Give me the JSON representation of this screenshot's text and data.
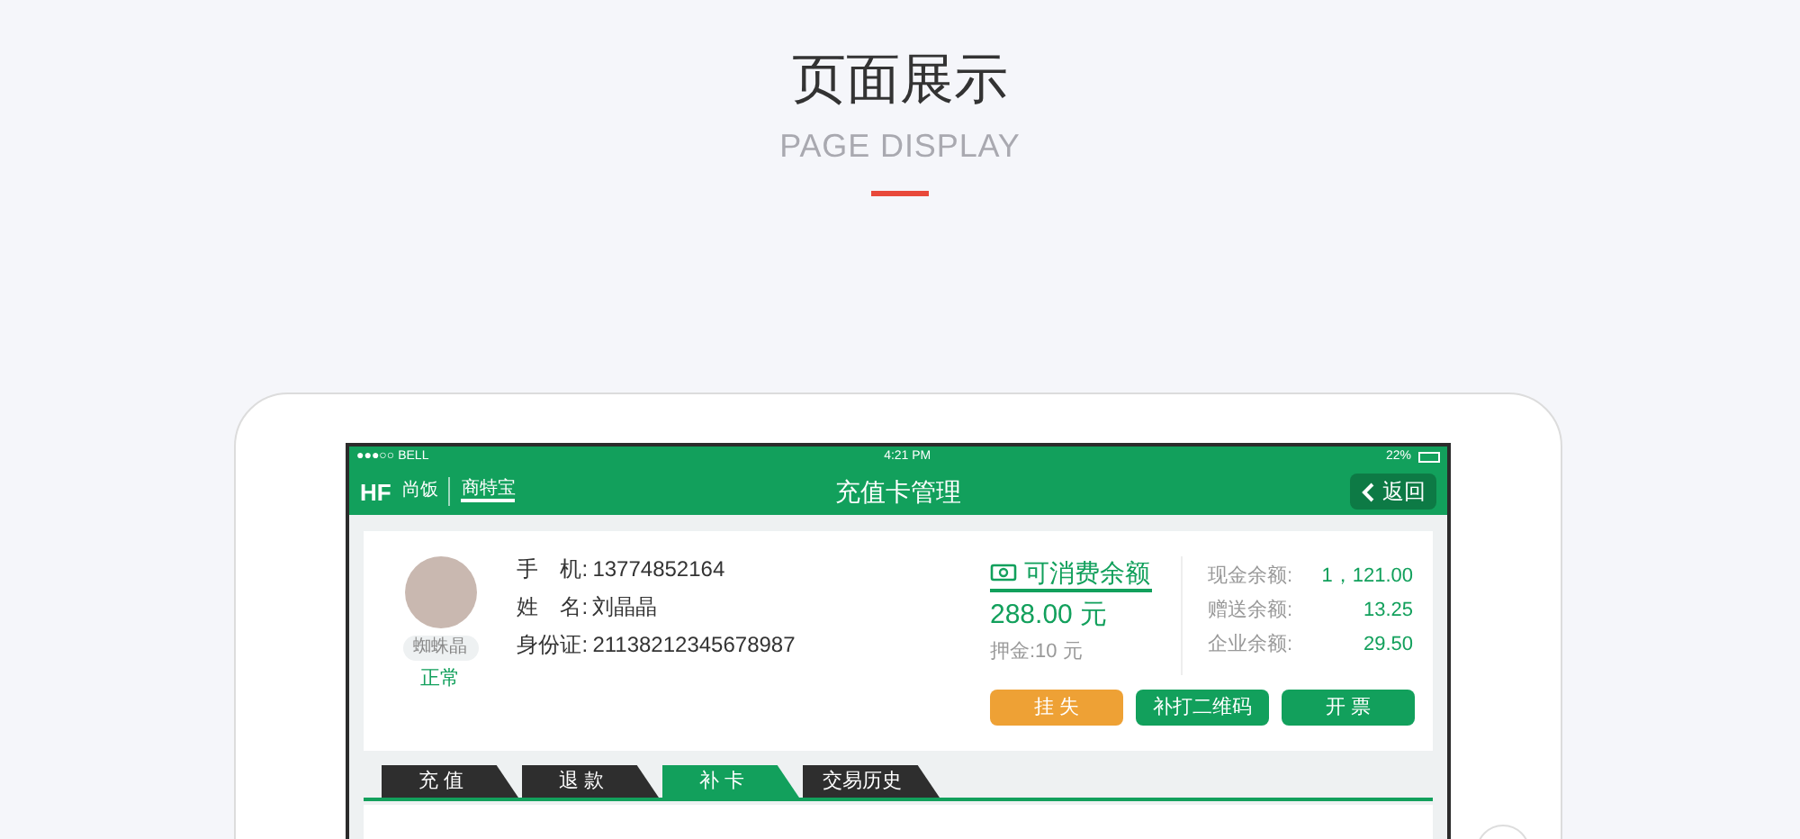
{
  "header": {
    "title": "页面展示",
    "subtitle": "PAGE DISPLAY"
  },
  "status_bar": {
    "carrier": "●●●○○ BELL",
    "time": "4:21 PM",
    "battery": "22%"
  },
  "nav_bar": {
    "logo_left": "HF",
    "logo_left_name": "尚饭",
    "logo_right": "商特宝",
    "title": "充值卡管理",
    "back_button": "返回"
  },
  "member": {
    "nickname": "蜘蛛晶",
    "status": "正常",
    "fields": [
      {
        "label": "手　机:",
        "value": "13774852164"
      },
      {
        "label": "姓　名:",
        "value": "刘晶晶"
      },
      {
        "label": "身份证:",
        "value": "21138212345678987"
      }
    ]
  },
  "balance": {
    "title": "可消费余额",
    "amount": "288.00 元",
    "deposit": "押金:10 元",
    "details": [
      {
        "label": "现金余额:",
        "value": "1，121.00"
      },
      {
        "label": "赠送余额:",
        "value": "13.25"
      },
      {
        "label": "企业余额:",
        "value": "29.50"
      }
    ]
  },
  "actions": [
    {
      "label": "挂 失",
      "kind": "warning"
    },
    {
      "label": "补打二维码",
      "kind": "primary"
    },
    {
      "label": "开 票",
      "kind": "primary"
    }
  ],
  "tabs": [
    {
      "label": "充 值",
      "selected": false
    },
    {
      "label": "退 款",
      "selected": false
    },
    {
      "label": "补 卡",
      "selected": true
    },
    {
      "label": "交易历史",
      "selected": false
    }
  ]
}
